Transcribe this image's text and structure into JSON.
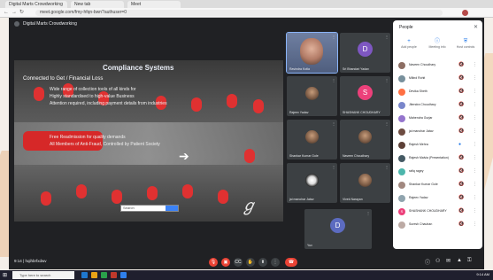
{
  "browser": {
    "tabs": [
      "Digital Marts Crowdworking",
      "New tab",
      "Meet"
    ],
    "url": "meet.google.com/fmy-hfqn-bwn?authuser=0"
  },
  "meet": {
    "window_title": "Digital Marts Crowdworking",
    "time": "9:14",
    "meeting_name": "hqihbrfxdwv",
    "slide": {
      "title": "Compliance Systems",
      "subtitle": "Connected to Get / Financial Loss",
      "lines": [
        "Wide range of collection tools of all kinds for",
        "Highly standardised to high-value Business",
        "Attention required, including payment details from industries",
        "Free Readmission for quality demands",
        "All Members of Anti-Fraud, Controlled by Patient Society"
      ],
      "search_placeholder": "Search"
    },
    "tiles": [
      {
        "name": "Ravindra Kotla",
        "initial": "",
        "color": ""
      },
      {
        "name": "Sri Bhandari Yadav",
        "initial": "D",
        "color": "#7e57c2"
      },
      {
        "name": "Rajeev Yadav",
        "initial": "",
        "color": ""
      },
      {
        "name": "SHASHANK CHOUDHARY",
        "initial": "S",
        "color": "#ec407a"
      },
      {
        "name": "Shankar Kumar Gole",
        "initial": "",
        "color": ""
      },
      {
        "name": "Naveen Choudhary",
        "initial": "",
        "color": ""
      },
      {
        "name": "jai manohar Jatav",
        "initial": "",
        "color": ""
      },
      {
        "name": "Vivek Narayan",
        "initial": "",
        "color": ""
      },
      {
        "name": "Yuv",
        "initial": "D",
        "color": "#5c6bc0"
      }
    ]
  },
  "controls": {
    "mic": "mic",
    "cam": "cam",
    "cc": "CC",
    "hand": "hand",
    "present": "present",
    "more": "more",
    "end": "end"
  },
  "people_panel": {
    "title": "People",
    "close": "✕",
    "actions": [
      "Add people",
      "Meeting info",
      "Host controls"
    ],
    "people": [
      {
        "name": "Naveen Choudhary",
        "color": "#8d6e63"
      },
      {
        "name": "Milind Rohit",
        "color": "#78909c"
      },
      {
        "name": "Devika Sheth",
        "color": "#ff7043"
      },
      {
        "name": "Jitendra Choudhary",
        "color": "#7986cb"
      },
      {
        "name": "Mahendra Gurjar",
        "color": "#9575cd"
      },
      {
        "name": "jai manohar Jatav",
        "color": "#6d4c41"
      },
      {
        "name": "Rajesh Mehra",
        "color": "#5d4037"
      },
      {
        "name": "Rajesh Malvia (Presentation)",
        "color": "#455a64"
      },
      {
        "name": "rafiq ragey",
        "color": "#4db6ac"
      },
      {
        "name": "Shankar Kumar Gole",
        "color": "#a1887f"
      },
      {
        "name": "Rajeev Yadav",
        "color": "#90a4ae"
      },
      {
        "name": "SHASHANK CHOUDHARY",
        "color": "#ec407a"
      },
      {
        "name": "Suresh Chauhan",
        "color": "#bcaaa4"
      }
    ]
  },
  "taskbar": {
    "search_placeholder": "Type here to search",
    "clock": "9:14 AM"
  }
}
